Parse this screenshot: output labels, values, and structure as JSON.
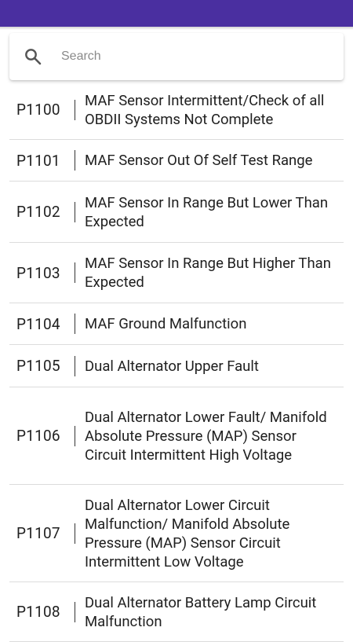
{
  "app": {
    "accent_color": "#4a2fa0"
  },
  "search": {
    "icon": "search-icon",
    "placeholder": "Search",
    "value": ""
  },
  "codes": [
    {
      "code": "P1100",
      "description": "MAF Sensor Intermittent/Check of all OBDII Systems Not Complete"
    },
    {
      "code": "P1101",
      "description": "MAF Sensor Out Of Self Test Range"
    },
    {
      "code": "P1102",
      "description": "MAF Sensor In Range But Lower Than Expected"
    },
    {
      "code": "P1103",
      "description": "MAF Sensor In Range But Higher Than Expected"
    },
    {
      "code": "P1104",
      "description": "MAF Ground Malfunction"
    },
    {
      "code": "P1105",
      "description": "Dual Alternator Upper Fault"
    },
    {
      "code": "P1106",
      "description": "Dual Alternator Lower Fault/ Manifold Absolute Pressure (MAP) Sensor Circuit Intermittent High Voltage"
    },
    {
      "code": "P1107",
      "description": "Dual Alternator Lower Circuit Malfunction/ Manifold Absolute Pressure (MAP) Sensor Circuit Intermittent Low Voltage"
    },
    {
      "code": "P1108",
      "description": "Dual Alternator Battery Lamp Circuit Malfunction"
    }
  ]
}
